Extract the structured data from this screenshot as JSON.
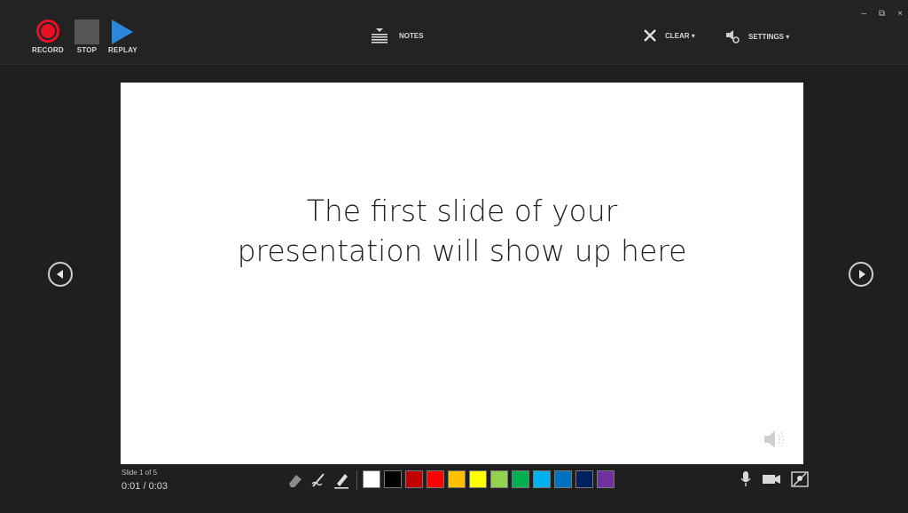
{
  "toolbar": {
    "record_label": "RECORD",
    "stop_label": "STOP",
    "replay_label": "REPLAY",
    "notes_label": "NOTES",
    "clear_label": "CLEAR ▾",
    "settings_label": "SETTINGS ▾"
  },
  "window_controls": {
    "minimize": "–",
    "restore": "⧉",
    "close": "×"
  },
  "slide": {
    "text_line1": "The first slide of your",
    "text_line2": "presentation will show up here"
  },
  "status": {
    "slide_counter": "Slide 1 of 5",
    "timer": "0:01  /  0:03"
  },
  "pen_colors": [
    "#ffffff",
    "#000000",
    "#c00000",
    "#ff0000",
    "#ffc000",
    "#ffff00",
    "#92d050",
    "#00b050",
    "#00b0f0",
    "#0070c0",
    "#002060",
    "#7030a0"
  ],
  "icons": {
    "record": "record-icon",
    "stop": "stop-icon",
    "replay": "play-icon",
    "notes": "notes-icon",
    "clear": "close-icon",
    "settings": "settings-icon",
    "eraser": "eraser-icon",
    "pen": "pen-icon",
    "highlighter": "highlighter-icon",
    "microphone": "microphone-icon",
    "camera": "camera-icon",
    "camera_preview": "camera-preview-icon",
    "speaker": "speaker-icon"
  }
}
